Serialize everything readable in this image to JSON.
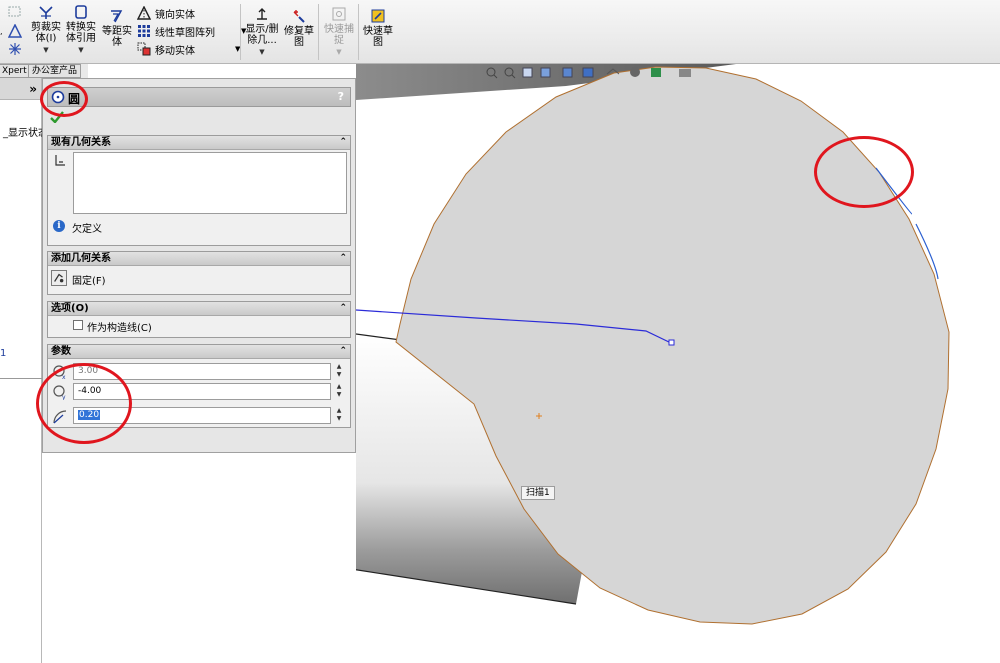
{
  "ribbon": {
    "trim": "剪裁实\n体(I)",
    "convert": "转换实\n体引用",
    "offset": "等距实\n体",
    "mirror": "镜向实体",
    "linear_pattern": "线性草图阵列",
    "move": "移动实体",
    "show_delete": "显示/删\n除几...",
    "repair": "修复草\n图",
    "quick_snap": "快速捕\n捉",
    "quick_sketch": "快速草\n图"
  },
  "tabs": [
    "Xpert",
    "办公室产品"
  ],
  "tree": {
    "expand": "»",
    "item": "_显示状态"
  },
  "prop": {
    "title": "圆",
    "help": "?",
    "existing_relations": {
      "header": "现有几何关系",
      "status": "欠定义"
    },
    "add_relations": {
      "header": "添加几何关系",
      "fixed": "固定(F)"
    },
    "options": {
      "header": "选项(O)",
      "construction": "作为构造线(C)"
    },
    "params": {
      "header": "参数",
      "cx": "3.00",
      "cy": "-4.00",
      "radius": "0.20"
    }
  },
  "viewport": {
    "sweep_label": "扫描1"
  },
  "colors": {
    "panel": "#e6e6e6",
    "annotation": "#e0161e",
    "sketch_line": "#2b2bd8",
    "face": "#d6d6d6"
  }
}
